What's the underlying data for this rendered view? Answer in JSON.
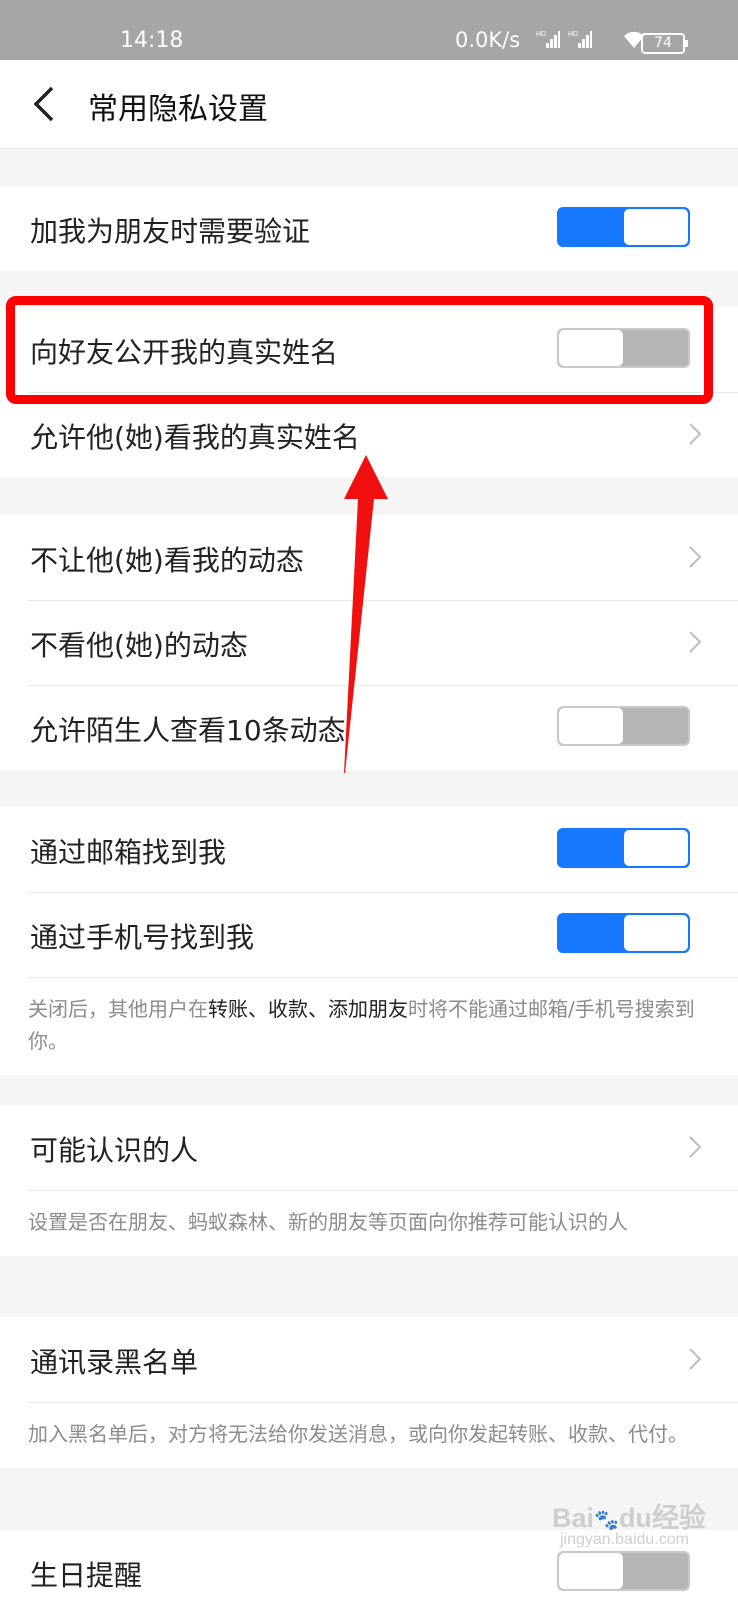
{
  "status_bar": {
    "time": "14:18",
    "network_speed": "0.0K/s",
    "signal_labels": [
      "HD",
      "HD"
    ],
    "battery": "74"
  },
  "header": {
    "title": "常用隐私设置"
  },
  "group1": {
    "verify_friend": {
      "label": "加我为朋友时需要验证",
      "state": "on"
    }
  },
  "group2": {
    "show_real_name": {
      "label": "向好友公开我的真实姓名",
      "state": "off"
    },
    "allow_view_name": {
      "label": "允许他(她)看我的真实姓名"
    }
  },
  "group3": {
    "hide_my_moments": {
      "label": "不让他(她)看我的动态"
    },
    "hide_their_moments": {
      "label": "不看他(她)的动态"
    },
    "stranger_ten_moments": {
      "label": "允许陌生人查看10条动态",
      "state": "off"
    }
  },
  "group4": {
    "find_by_email": {
      "label": "通过邮箱找到我",
      "state": "on"
    },
    "find_by_phone": {
      "label": "通过手机号找到我",
      "state": "on"
    },
    "note": {
      "prefix": "关闭后，其他用户在",
      "emphasis": "转账、收款、添加朋友",
      "suffix": "时将不能通过邮箱/手机号搜索到你。"
    }
  },
  "group5": {
    "people_you_may_know": {
      "label": "可能认识的人"
    },
    "note": "设置是否在朋友、蚂蚁森林、新的朋友等页面向你推荐可能认识的人"
  },
  "group6": {
    "contacts_blacklist": {
      "label": "通讯录黑名单"
    },
    "note": "加入黑名单后，对方将无法给你发送消息，或向你发起转账、收款、代付。"
  },
  "group7": {
    "birthday_reminder": {
      "label": "生日提醒",
      "state": "off"
    }
  },
  "watermark": {
    "brand": "Bai",
    "brand2": "du",
    "cn": "经验",
    "url": "jingyan.baidu.com"
  },
  "colors": {
    "accent": "#1677ff",
    "highlight": "#ff0000",
    "toggle_off": "#b5b5b5"
  }
}
